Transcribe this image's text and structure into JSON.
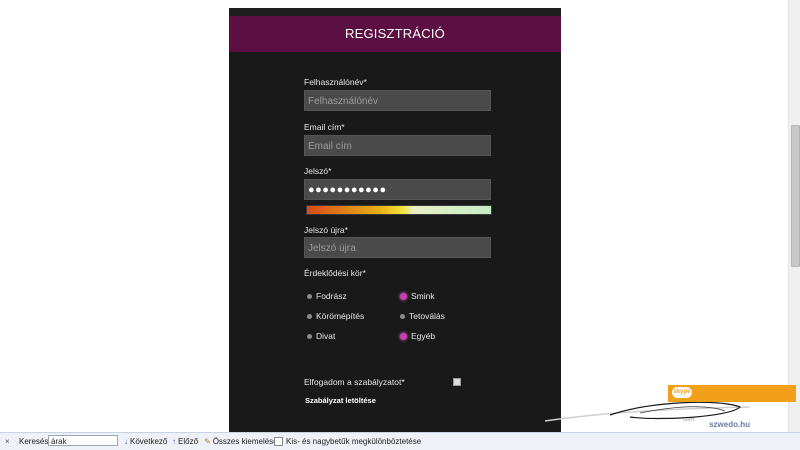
{
  "form": {
    "title": "REGISZTRÁCIÓ",
    "username_label": "Felhasználónév*",
    "username_placeholder": "Felhasználónév",
    "email_label": "Email cím*",
    "email_placeholder": "Email cím",
    "password_label": "Jelszó*",
    "password_value": "●●●●●●●●●●●",
    "password_strength": 0.6,
    "confirm_label": "Jelszó újra*",
    "confirm_placeholder": "Jelszó újra",
    "interests_label": "Érdeklődési kör*",
    "interests": [
      {
        "label": "Fodrász",
        "selected": false
      },
      {
        "label": "Smink",
        "selected": true
      },
      {
        "label": "Körömépítés",
        "selected": false
      },
      {
        "label": "Tetoválás",
        "selected": false
      },
      {
        "label": "Divat",
        "selected": false
      },
      {
        "label": "Egyéb",
        "selected": true
      }
    ],
    "terms_label": "Elfogadom a szabályzatot*",
    "terms_checked": false,
    "terms_download": "Szabályzat letöltése"
  },
  "ad": {
    "brand": "skype",
    "site": "szwedo.hu",
    "small_text": "szerv"
  },
  "findbar": {
    "close": "×",
    "label": "Keresés:",
    "query": "árak",
    "next": "Következő",
    "prev": "Előző",
    "highlight_all": "Összes kiemelése",
    "match_case": "Kis- és nagybetűk megkülönböztetése"
  },
  "colors": {
    "header": "#5b0f43",
    "panel": "#191919",
    "selected_radio": "#c93fb4",
    "ad_orange": "#f2a01a"
  }
}
